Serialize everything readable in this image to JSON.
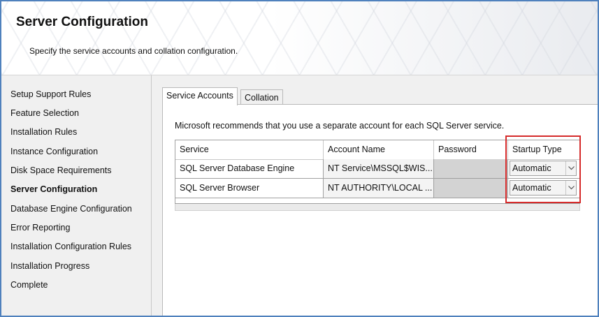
{
  "header": {
    "title": "Server Configuration",
    "subtitle": "Specify the service accounts and collation configuration."
  },
  "sidebar": {
    "items": [
      {
        "label": "Setup Support Rules"
      },
      {
        "label": "Feature Selection"
      },
      {
        "label": "Installation Rules"
      },
      {
        "label": "Instance Configuration"
      },
      {
        "label": "Disk Space Requirements"
      },
      {
        "label": "Server Configuration",
        "active": true
      },
      {
        "label": "Database Engine Configuration"
      },
      {
        "label": "Error Reporting"
      },
      {
        "label": "Installation Configuration Rules"
      },
      {
        "label": "Installation Progress"
      },
      {
        "label": "Complete"
      }
    ]
  },
  "tabs": [
    {
      "label": "Service Accounts",
      "active": true
    },
    {
      "label": "Collation",
      "active": false
    }
  ],
  "service_accounts": {
    "recommendation": "Microsoft recommends that you use a separate account for each SQL Server service.",
    "columns": [
      "Service",
      "Account Name",
      "Password",
      "Startup Type"
    ],
    "rows": [
      {
        "service": "SQL Server Database Engine",
        "account": "NT Service\\MSSQL$WIS...",
        "password": "",
        "startup_type": "Automatic"
      },
      {
        "service": "SQL Server Browser",
        "account": "NT AUTHORITY\\LOCAL ...",
        "password": "",
        "startup_type": "Automatic"
      }
    ]
  },
  "colors": {
    "highlight_border": "#d52b2b",
    "frame_border": "#4f81bd",
    "password_cell_bg": "#d3d3d3"
  },
  "icons": {
    "dropdown": "chevron-down-icon"
  }
}
